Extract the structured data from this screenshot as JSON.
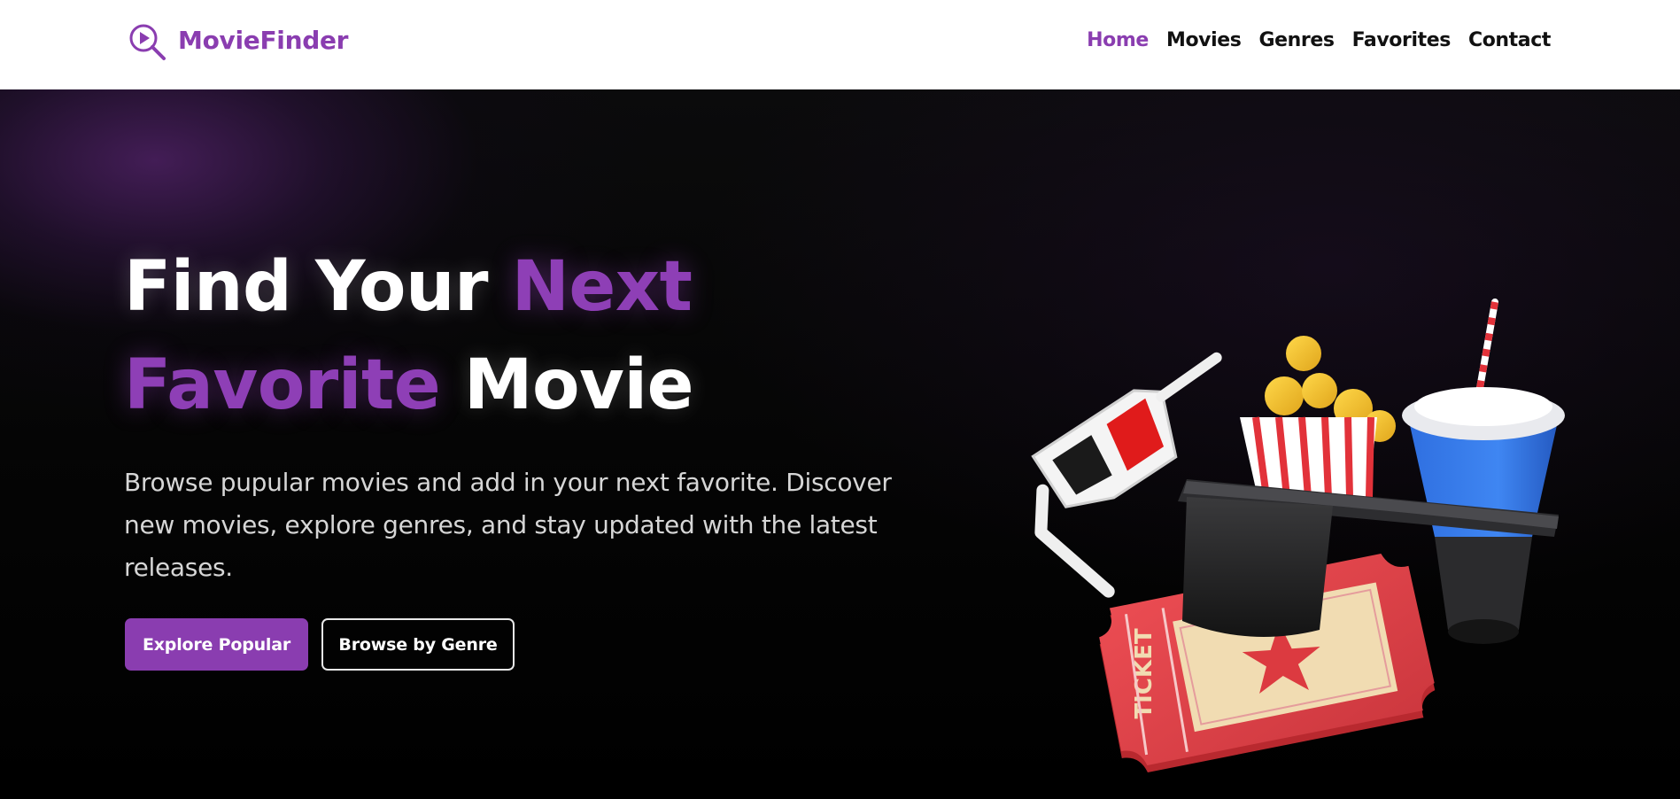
{
  "brand": {
    "name": "MovieFinder",
    "icon": "search-play-icon",
    "color": "#8a3db0"
  },
  "nav": {
    "items": [
      {
        "label": "Home",
        "active": true
      },
      {
        "label": "Movies",
        "active": false
      },
      {
        "label": "Genres",
        "active": false
      },
      {
        "label": "Favorites",
        "active": false
      },
      {
        "label": "Contact",
        "active": false
      }
    ]
  },
  "hero": {
    "title_part1": "Find Your ",
    "title_part2": "Next",
    "title_part3": "Favorite",
    "title_part4": " Movie",
    "description": "Browse pupular movies and add in your next favorite. Discover new movies, explore genres, and stay updated with the latest releases.",
    "primary_button": "Explore Popular",
    "secondary_button": "Browse by Genre",
    "illustration_icon": "cinema-3d-glasses-popcorn-ticket-drink-icon"
  },
  "colors": {
    "accent": "#8a3db0",
    "background": "#000000",
    "navbar_bg": "#ffffff"
  }
}
